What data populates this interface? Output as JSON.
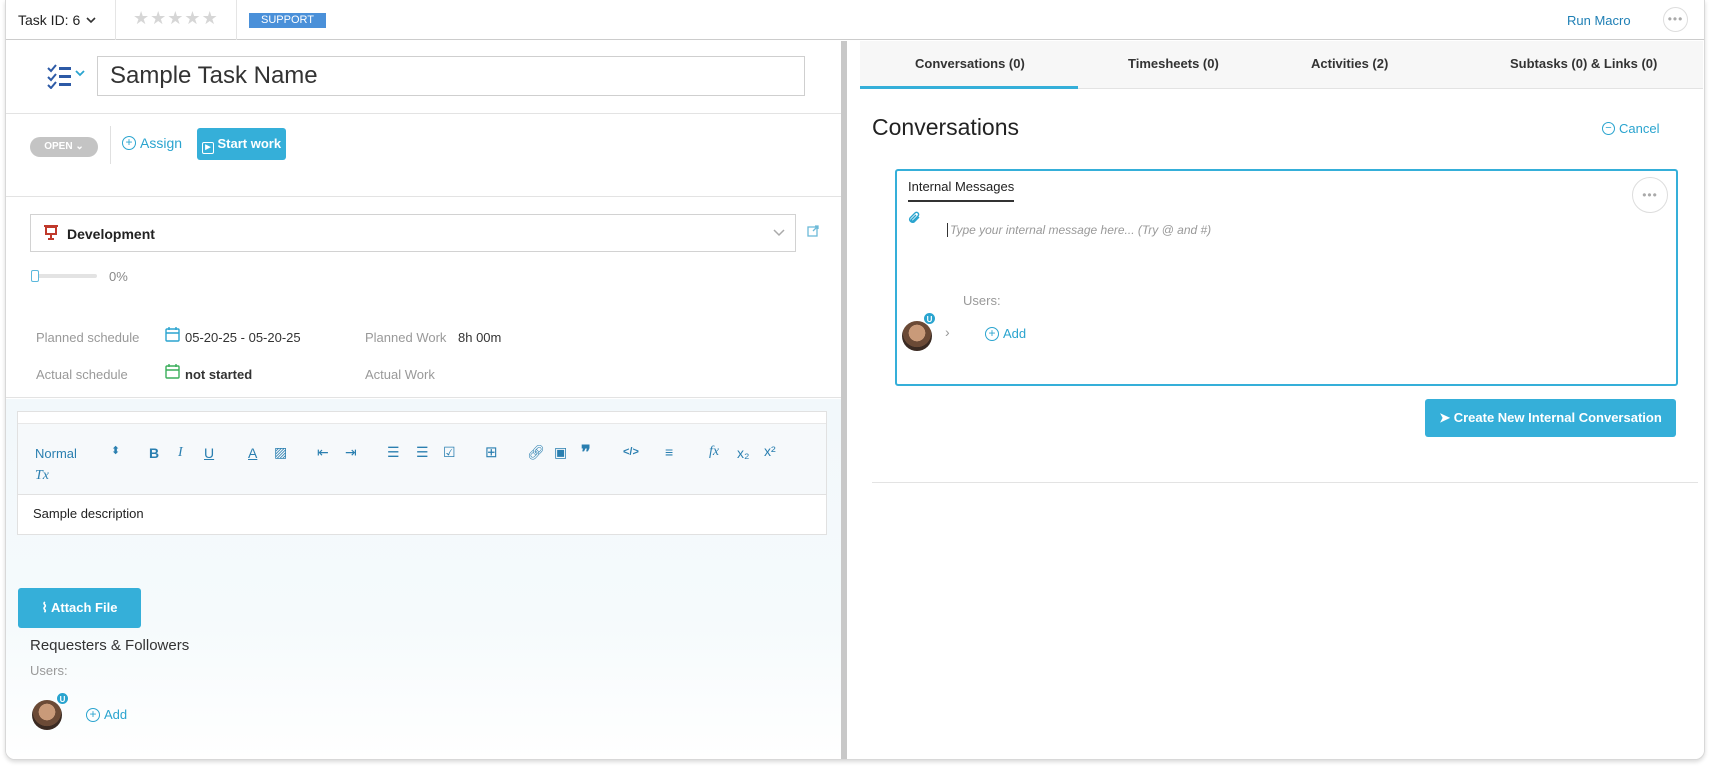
{
  "topbar": {
    "task_id_label": "Task ID: 6",
    "rating_stars": 5,
    "support_badge": "SUPPORT",
    "run_macro": "Run Macro",
    "more_icon": "ellipsis-icon"
  },
  "task": {
    "title": "Sample Task Name",
    "status": "OPEN",
    "assign_label": "Assign",
    "start_work_label": "Start work",
    "project": "Development",
    "progress_value": "0%",
    "progress_fraction": 0,
    "planned_schedule_label": "Planned schedule",
    "planned_schedule_value": "05-20-25 - 05-20-25",
    "planned_work_label": "Planned Work",
    "planned_work_value": "8h 00m",
    "actual_schedule_label": "Actual schedule",
    "actual_schedule_value": "not started",
    "actual_work_label": "Actual Work"
  },
  "editor": {
    "format_select": "Normal",
    "content": "Sample description"
  },
  "attach_file_label": "Attach File",
  "requesters": {
    "title": "Requesters & Followers",
    "users_label": "Users:",
    "avatar_badge": "U",
    "add_label": "Add"
  },
  "tabs": [
    {
      "label": "Conversations (0)"
    },
    {
      "label": "Timesheets (0)"
    },
    {
      "label": "Activities (2)"
    },
    {
      "label": "Subtasks (0) & Links (0)"
    }
  ],
  "conversations": {
    "title": "Conversations",
    "cancel_label": "Cancel",
    "internal_tab": "Internal Messages",
    "placeholder": "Type your internal message here... (Try @ and #)",
    "users_label": "Users:",
    "avatar_badge": "U",
    "add_label": "Add",
    "create_button": "Create New Internal Conversation"
  },
  "colors": {
    "accent": "#35afd9",
    "link": "#2aa4cf",
    "support_badge": "#4a90d9",
    "project_icon": "#c0392b"
  }
}
